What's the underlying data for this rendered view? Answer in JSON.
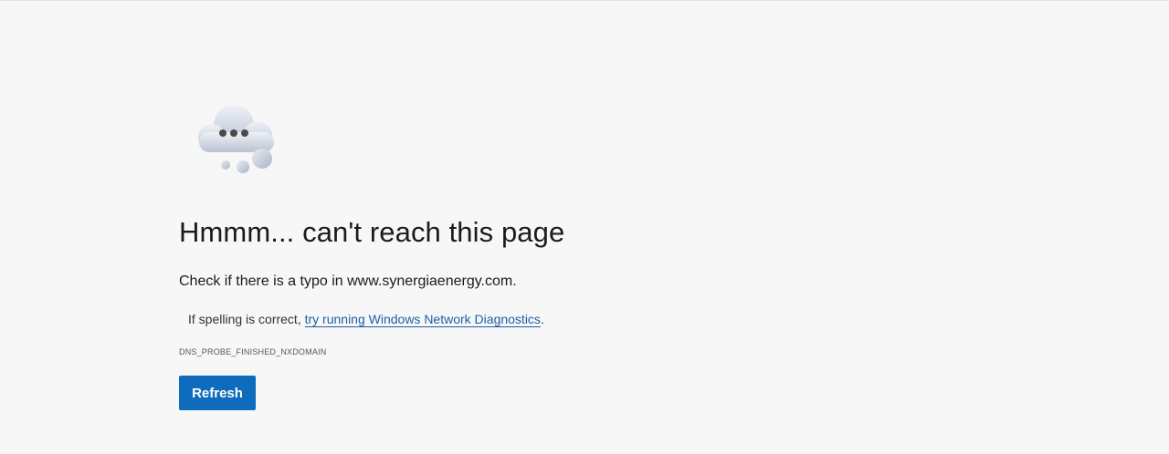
{
  "error_page": {
    "title": "Hmmm... can't reach this page",
    "typo_prefix": "Check if there is a typo in ",
    "domain": "www.synergiaenergy.com",
    "typo_suffix": ".",
    "suggestion_prefix": "If spelling is correct, ",
    "diagnostics_link": "try running Windows Network Diagnostics",
    "suggestion_suffix": ".",
    "error_code": "DNS_PROBE_FINISHED_NXDOMAIN",
    "refresh_label": "Refresh",
    "illustration_icon": "cloud-thinking-icon"
  },
  "colors": {
    "background": "#f7f7f7",
    "button": "#0f6cbd",
    "link": "#1d5fa8"
  }
}
